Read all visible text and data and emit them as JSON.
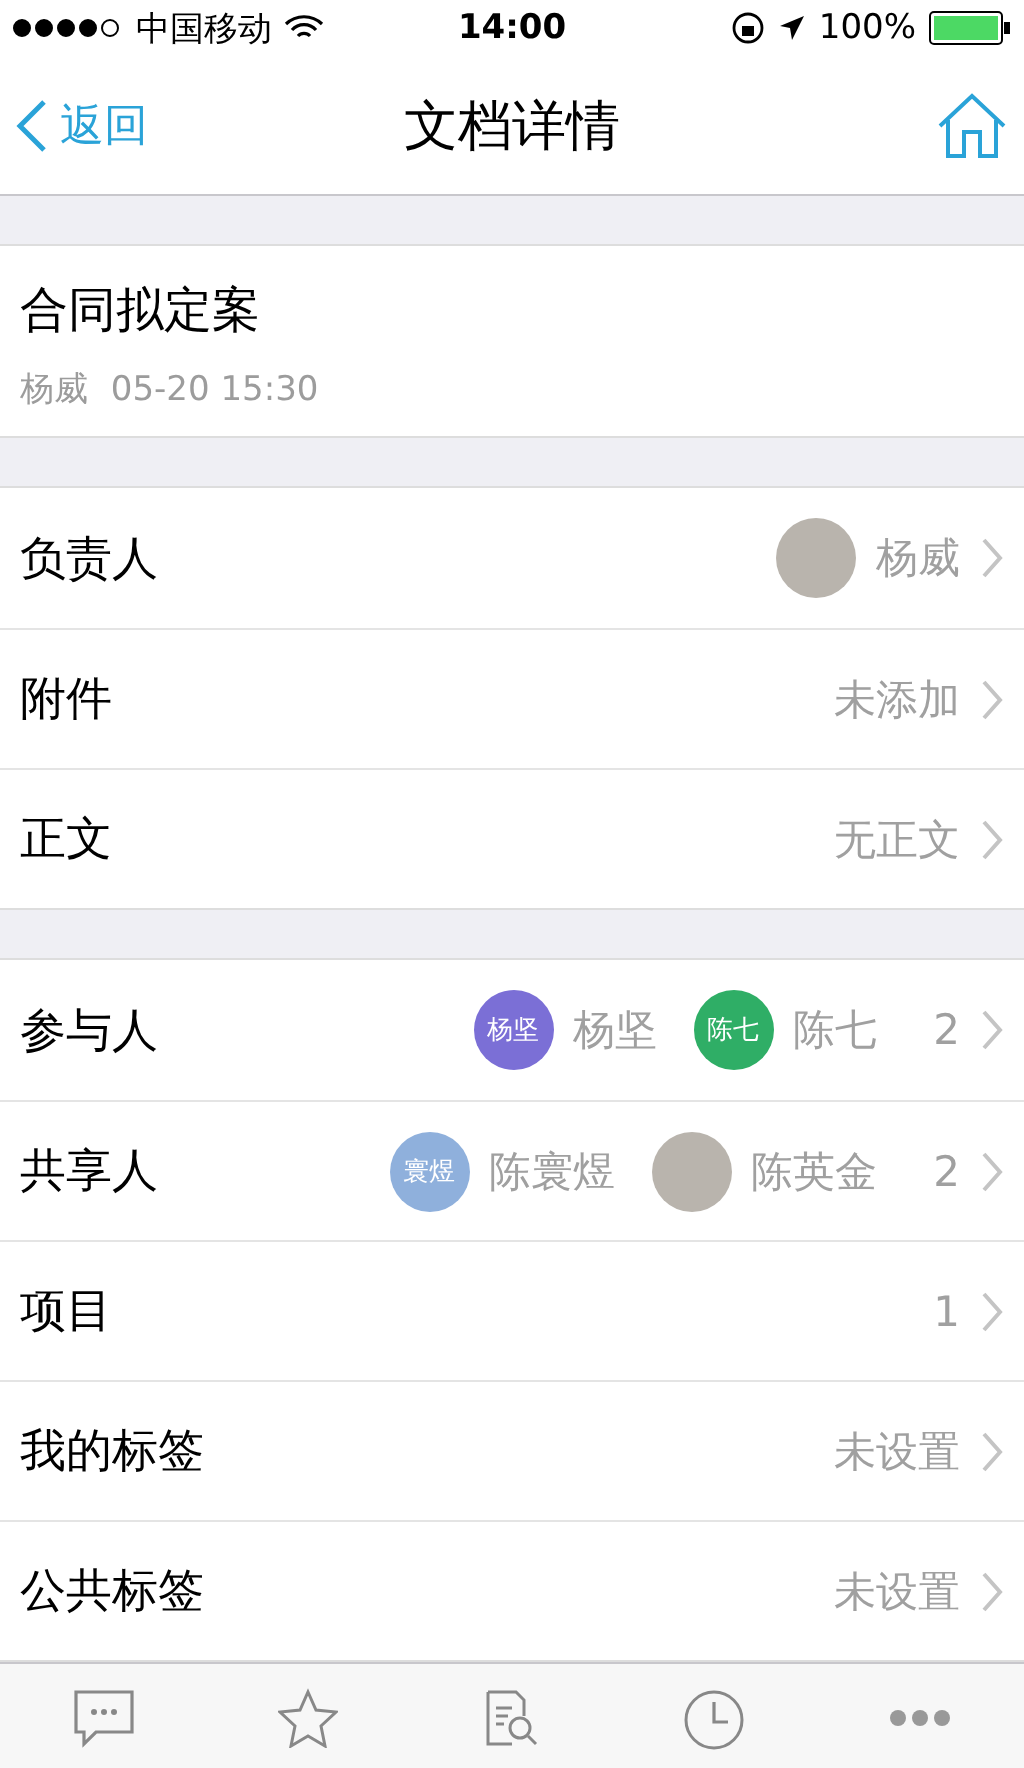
{
  "status_bar": {
    "carrier": "中国移动",
    "time": "14:00",
    "battery": "100%"
  },
  "nav": {
    "back": "返回",
    "title": "文档详情"
  },
  "document": {
    "title": "合同拟定案",
    "author": "杨威",
    "time": "05-20 15:30"
  },
  "sections": [
    {
      "rows": [
        {
          "label": "负责人",
          "people": [
            {
              "name": "杨威",
              "kind": "photo"
            }
          ]
        },
        {
          "label": "附件",
          "value": "未添加"
        },
        {
          "label": "正文",
          "value": "无正文"
        }
      ]
    },
    {
      "rows": [
        {
          "label": "参与人",
          "people": [
            {
              "name": "杨坚",
              "kind": "initials",
              "initials": "杨坚",
              "color": "#7b6fd6"
            },
            {
              "name": "陈七",
              "kind": "initials",
              "initials": "陈七",
              "color": "#2fae66"
            }
          ],
          "count": "2"
        },
        {
          "label": "共享人",
          "people": [
            {
              "name": "陈寰煜",
              "kind": "initials",
              "initials": "寰煜",
              "color": "#8fb0dc"
            },
            {
              "name": "陈英金",
              "kind": "photo"
            }
          ],
          "count": "2"
        },
        {
          "label": "项目",
          "count": "1"
        },
        {
          "label": "我的标签",
          "value": "未设置"
        },
        {
          "label": "公共标签",
          "value": "未设置"
        }
      ]
    }
  ],
  "tab_bar": [
    {
      "kind": "chat"
    },
    {
      "kind": "star"
    },
    {
      "kind": "doc-search"
    },
    {
      "kind": "clock"
    },
    {
      "kind": "more"
    }
  ]
}
